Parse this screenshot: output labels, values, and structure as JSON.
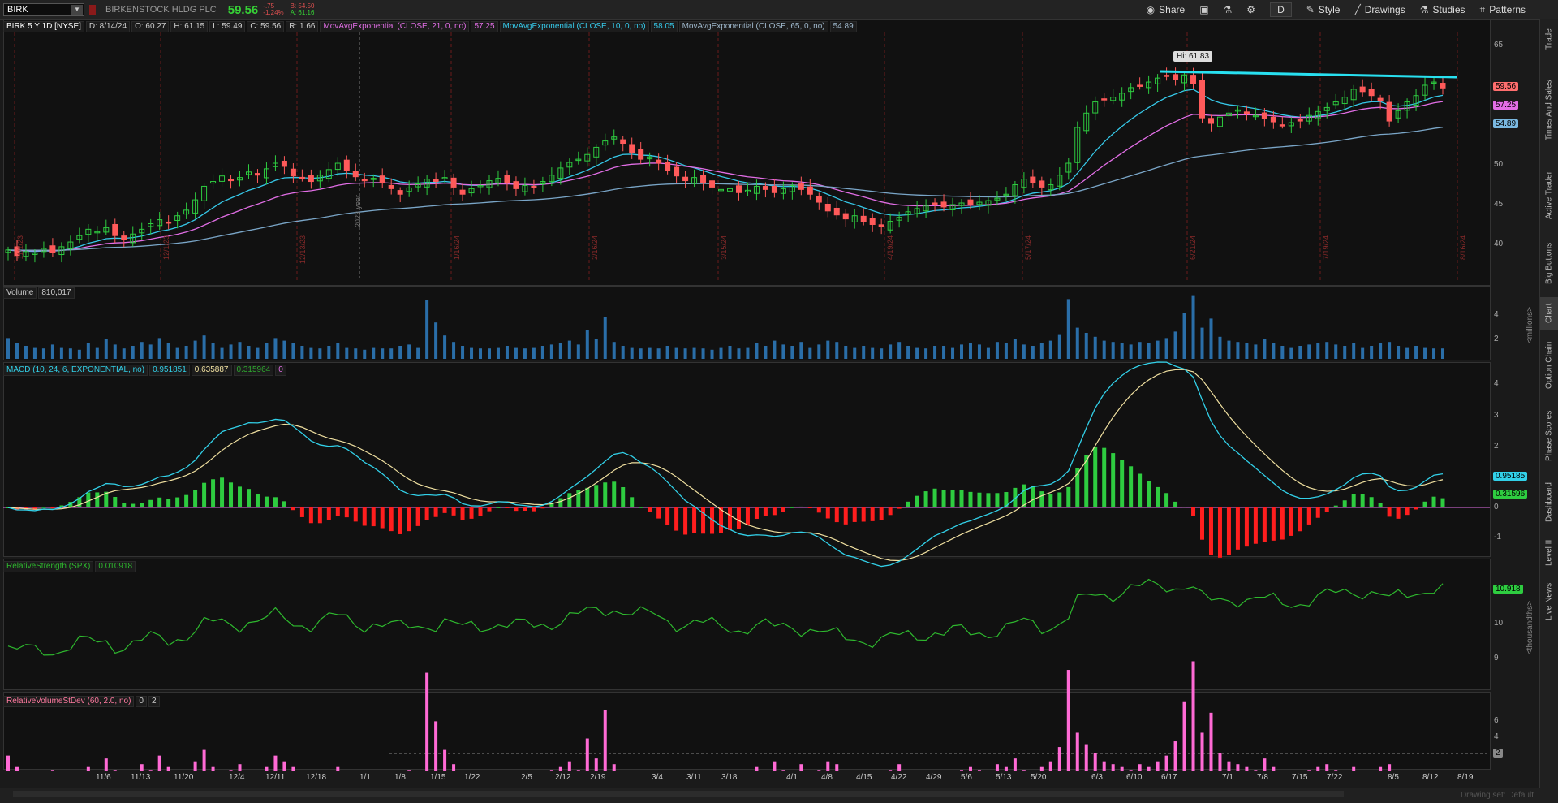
{
  "topbar": {
    "symbol": "BIRK",
    "company": "BIRKENSTOCK HLDG PLC",
    "last": "59.56",
    "change": "-.75",
    "change_pct": "-1.24%",
    "bid": "B: 54.50",
    "ask": "A: 61.16",
    "share_label": "Share",
    "period_label": "D",
    "style_label": "Style",
    "drawings_label": "Drawings",
    "studies_label": "Studies",
    "patterns_label": "Patterns"
  },
  "sidebar": {
    "tabs": [
      "Trade",
      "Times And Sales",
      "Active Trader",
      "Big Buttons",
      "Chart",
      "Option Chain",
      "Phase Scores",
      "Dashboard",
      "Level II",
      "Live News"
    ]
  },
  "price_pane": {
    "title": "BIRK 5 Y 1D [NYSE]",
    "date": "D: 8/14/24",
    "open": "O: 60.27",
    "high": "H: 61.15",
    "low": "L: 59.49",
    "close": "C: 59.56",
    "range": "R: 1.66",
    "ema21_label": "MovAvgExponential (CLOSE, 21, 0, no)",
    "ema21_value": "57.25",
    "ema10_label": "MovAvgExponential (CLOSE, 10, 0, no)",
    "ema10_value": "58.05",
    "ema65_label": "MovAvgExponential (CLOSE, 65, 0, no)",
    "ema65_value": "54.89",
    "hi_label": "Hi: 61.83",
    "price_tag": "59.56",
    "ema21_tag": "57.25",
    "ema65_tag": "54.89",
    "scale": [
      "65",
      "50",
      "45",
      "40"
    ],
    "year_marker": "2023 year",
    "date_lines": [
      "11/1/23",
      "12/1/23",
      "12/13/23",
      "1/16/24",
      "2/16/24",
      "3/15/24",
      "4/19/24",
      "5/17/24",
      "6/21/24",
      "7/19/24",
      "8/16/24"
    ]
  },
  "volume_pane": {
    "label": "Volume",
    "value": "810,017",
    "scale": [
      "4",
      "2"
    ],
    "unit": "<millions>"
  },
  "macd_pane": {
    "label": "MACD (10, 24, 6, EXPONENTIAL, no)",
    "value": "0.951851",
    "avg": "0.635887",
    "diff": "0.315964",
    "zero": "0",
    "scale": [
      "4",
      "3",
      "2",
      "1",
      "0",
      "-1"
    ],
    "value_tag": "0.95185",
    "diff_tag": "0.31596"
  },
  "rs_pane": {
    "label": "RelativeStrength (SPX)",
    "value": "0.010918",
    "scale": [
      "10",
      "9"
    ],
    "value_tag": "10.918",
    "unit": "<thousandths>"
  },
  "rvol_pane": {
    "label": "RelativeVolumeStDev (60, 2.0, no)",
    "v1": "0",
    "v2": "2",
    "scale": [
      "6",
      "4"
    ],
    "tag": "2"
  },
  "time_axis": [
    "11/6",
    "11/13",
    "11/20",
    "12/4",
    "12/11",
    "12/18",
    "1/1",
    "1/8",
    "1/15",
    "1/22",
    "2/5",
    "2/12",
    "2/19",
    "3/4",
    "3/11",
    "3/18",
    "4/1",
    "4/8",
    "4/15",
    "4/22",
    "4/29",
    "5/6",
    "5/13",
    "5/20",
    "6/3",
    "6/10",
    "6/17",
    "7/1",
    "7/8",
    "7/15",
    "7/22",
    "8/5",
    "8/12",
    "8/19"
  ],
  "footer": {
    "hint": "Drawing set: Default"
  },
  "chart_data": [
    {
      "type": "candlestick",
      "title": "BIRK 5 Y 1D [NYSE]",
      "closes": [
        39.2,
        38.5,
        39,
        38.8,
        39.4,
        38.9,
        39.6,
        40.2,
        41,
        41.8,
        41.5,
        42,
        41,
        40.5,
        41.2,
        41.8,
        42.5,
        43,
        42.6,
        43.5,
        44.2,
        45.5,
        47.2,
        47.8,
        48.5,
        47.9,
        48.3,
        49,
        48.6,
        49.4,
        50.1,
        49.7,
        48.5,
        48.2,
        47.8,
        48.6,
        49.3,
        50.1,
        49.2,
        48.4,
        47.9,
        48.2,
        47.6,
        46.9,
        46.2,
        47,
        47.5,
        48.1,
        47.8,
        48.3,
        47.1,
        46.2,
        46.9,
        47.3,
        47.9,
        48.2,
        47.6,
        46.9,
        47.3,
        47.1,
        47.8,
        48.6,
        49.5,
        50.2,
        50.6,
        51.2,
        52.1,
        52.9,
        53.4,
        52.6,
        51.4,
        50.6,
        50.9,
        50.1,
        49.2,
        48.5,
        47.9,
        48.3,
        47.6,
        47.1,
        46.8,
        46.9,
        46.4,
        46.7,
        47.2,
        46.8,
        46.4,
        46.9,
        47.3,
        46.8,
        46.2,
        45.2,
        44.1,
        43.6,
        43.1,
        43.5,
        42.8,
        42.4,
        42.1,
        42.8,
        43.3,
        44,
        44.4,
        44.8,
        45,
        44.6,
        44.9,
        45.1,
        44.9,
        45.2,
        45.4,
        45.7,
        46.2,
        47.4,
        48.1,
        47.6,
        47.1,
        47.4,
        48.6,
        50.1,
        54.6,
        56.4,
        57.8,
        58.1,
        58.4,
        58.9,
        59.6,
        59.9,
        60.3,
        60.8,
        61.1,
        60.6,
        61.2,
        60.1,
        55.8,
        55.1,
        55.9,
        56.4,
        56.8,
        56.3,
        56.1,
        55.7,
        55.3,
        54.9,
        55.2,
        55.4,
        56.1,
        56.6,
        57.1,
        57.8,
        58.4,
        59.4,
        59.1,
        58.6,
        57.9,
        55.4,
        56.7,
        57.8,
        58.6,
        59.9,
        60.3,
        59.56
      ],
      "ema10_last": 58.05,
      "ema21_last": 57.25,
      "ema65_last": 54.89,
      "ylim": [
        36,
        66
      ],
      "hi": 61.83
    },
    {
      "type": "bar",
      "title": "Volume",
      "unit": "millions",
      "values": [
        1.6,
        1.2,
        1,
        0.9,
        0.8,
        1.1,
        0.9,
        0.8,
        0.7,
        1.2,
        0.9,
        1.5,
        1.1,
        0.8,
        1,
        1.3,
        1.1,
        1.6,
        1.2,
        0.9,
        1,
        1.4,
        1.8,
        1.2,
        0.9,
        1.1,
        1.3,
        1,
        0.9,
        1.2,
        1.6,
        1.4,
        1.2,
        1,
        0.9,
        0.8,
        1,
        1.2,
        0.9,
        0.8,
        0.7,
        0.9,
        0.8,
        0.8,
        1,
        1.1,
        0.9,
        4.5,
        2.8,
        1.8,
        1.3,
        1,
        0.9,
        0.8,
        0.8,
        0.9,
        1,
        0.9,
        0.8,
        0.9,
        1,
        1.1,
        1.2,
        1.4,
        1.1,
        2.2,
        1.5,
        3.2,
        1.3,
        1,
        0.9,
        0.8,
        0.9,
        0.8,
        1,
        0.9,
        0.8,
        0.9,
        0.8,
        0.7,
        0.9,
        1,
        0.8,
        0.9,
        1.2,
        1,
        1.4,
        1.1,
        1,
        1.3,
        0.9,
        1.1,
        1.4,
        1.3,
        1,
        0.9,
        1,
        0.9,
        0.8,
        1.1,
        1.3,
        1,
        0.9,
        0.8,
        1,
        1,
        0.9,
        1.1,
        1.2,
        1.1,
        0.9,
        1.3,
        1.2,
        1.5,
        1.1,
        1,
        1.2,
        1.4,
        1.9,
        4.6,
        2.4,
        2,
        1.7,
        1.4,
        1.3,
        1.2,
        1.1,
        1.3,
        1.2,
        1.4,
        1.6,
        2.1,
        3.5,
        4.9,
        2.4,
        3.1,
        1.7,
        1.4,
        1.3,
        1.2,
        1.1,
        1.5,
        1.2,
        1,
        0.9,
        1,
        1.1,
        1.2,
        1.3,
        1.1,
        1,
        1.2,
        0.9,
        1,
        1.2,
        1.3,
        1,
        0.9,
        1,
        0.9,
        0.8,
        0.8
      ]
    },
    {
      "type": "line",
      "title": "MACD (10, 24, 6, EXPONENTIAL, no)",
      "macd_last": 0.951851,
      "avg_last": 0.635887,
      "diff_last": 0.315964,
      "ylim": [
        -1.5,
        4.2
      ]
    },
    {
      "type": "line",
      "title": "RelativeStrength (SPX)",
      "unit": "thousandths",
      "last": 10.918,
      "ylim": [
        8.4,
        11.3
      ]
    },
    {
      "type": "bar",
      "title": "RelativeVolumeStDev (60, 2.0, no)",
      "ylim": [
        0,
        7
      ]
    }
  ],
  "colors": {
    "up": "#2ecc40",
    "down": "#ff5a5a",
    "ema10": "#36c8e8",
    "ema21": "#e26ee6",
    "ema65": "#7aa6c8",
    "volume": "#2a6ea8",
    "macd": "#32d0e8",
    "macd_avg": "#f0e0a0",
    "rs": "#2eb82e",
    "rvol": "#ff6ad5",
    "hiline": "#28e0f0"
  }
}
